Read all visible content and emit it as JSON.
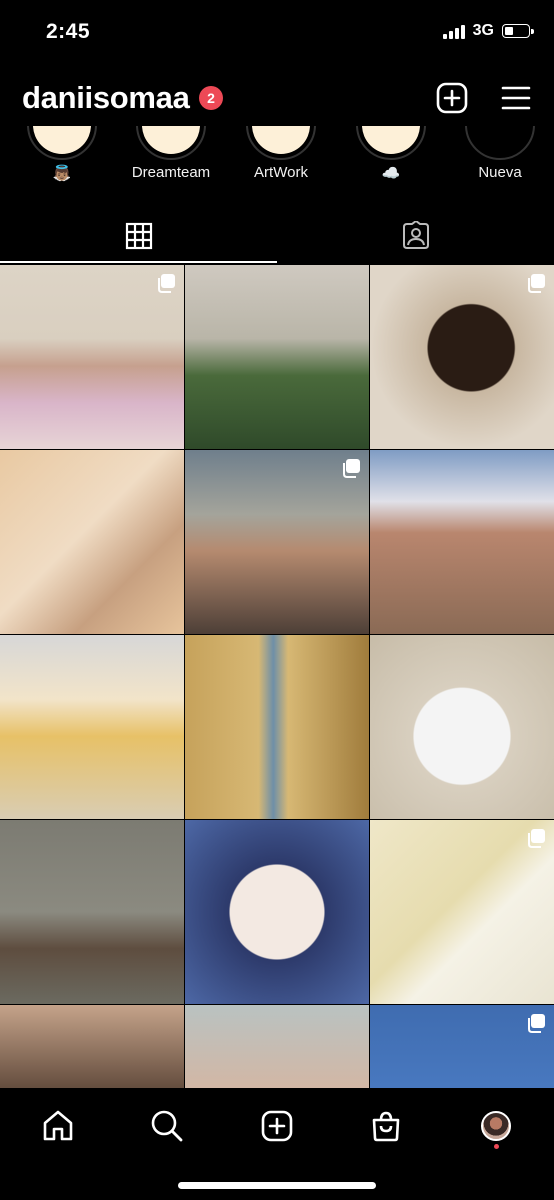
{
  "status_bar": {
    "time": "2:45",
    "network": "3G",
    "battery_level": 0.4
  },
  "header": {
    "username": "daniisomaa",
    "notification_count": "2",
    "icons": {
      "create": "plus-square-icon",
      "menu": "hamburger-menu-icon"
    }
  },
  "highlights": [
    {
      "label": "👼🏽"
    },
    {
      "label": "Dreamteam"
    },
    {
      "label": "ArtWork"
    },
    {
      "label": "☁️"
    },
    {
      "label": "Nueva"
    }
  ],
  "tabs": [
    {
      "icon": "grid-icon",
      "active": true
    },
    {
      "icon": "tagged-person-icon",
      "active": false
    }
  ],
  "posts": [
    {
      "subject": "girl with curly hair in lilac off-shoulder top",
      "multiple": true
    },
    {
      "subject": "palm trees against hazy sky with moon",
      "multiple": false
    },
    {
      "subject": "mirror selfie with face mask",
      "multiple": true
    },
    {
      "subject": "hand holding glass of milky drink",
      "multiple": false
    },
    {
      "subject": "smiling girl under lit arcade",
      "multiple": true
    },
    {
      "subject": "building facade with movie posters",
      "multiple": false
    },
    {
      "subject": "cakes in bakery display",
      "multiple": false
    },
    {
      "subject": "yellow wall with arched windows",
      "multiple": false
    },
    {
      "subject": "white balloons in corner",
      "multiple": false
    },
    {
      "subject": "feet in brown converse sneakers",
      "multiple": false
    },
    {
      "subject": "bowl of ramen on blue tile",
      "multiple": false
    },
    {
      "subject": "sacred heart decorations on yellow wall",
      "multiple": true
    },
    {
      "subject": "girl with ring covering eye",
      "multiple": false
    },
    {
      "subject": "legs in water",
      "multiple": false
    },
    {
      "subject": "face against blue sky",
      "multiple": true
    }
  ],
  "bottom_nav": [
    {
      "icon": "home-icon"
    },
    {
      "icon": "search-icon"
    },
    {
      "icon": "create-post-icon"
    },
    {
      "icon": "shop-bag-icon"
    },
    {
      "icon": "profile-avatar-icon"
    }
  ]
}
